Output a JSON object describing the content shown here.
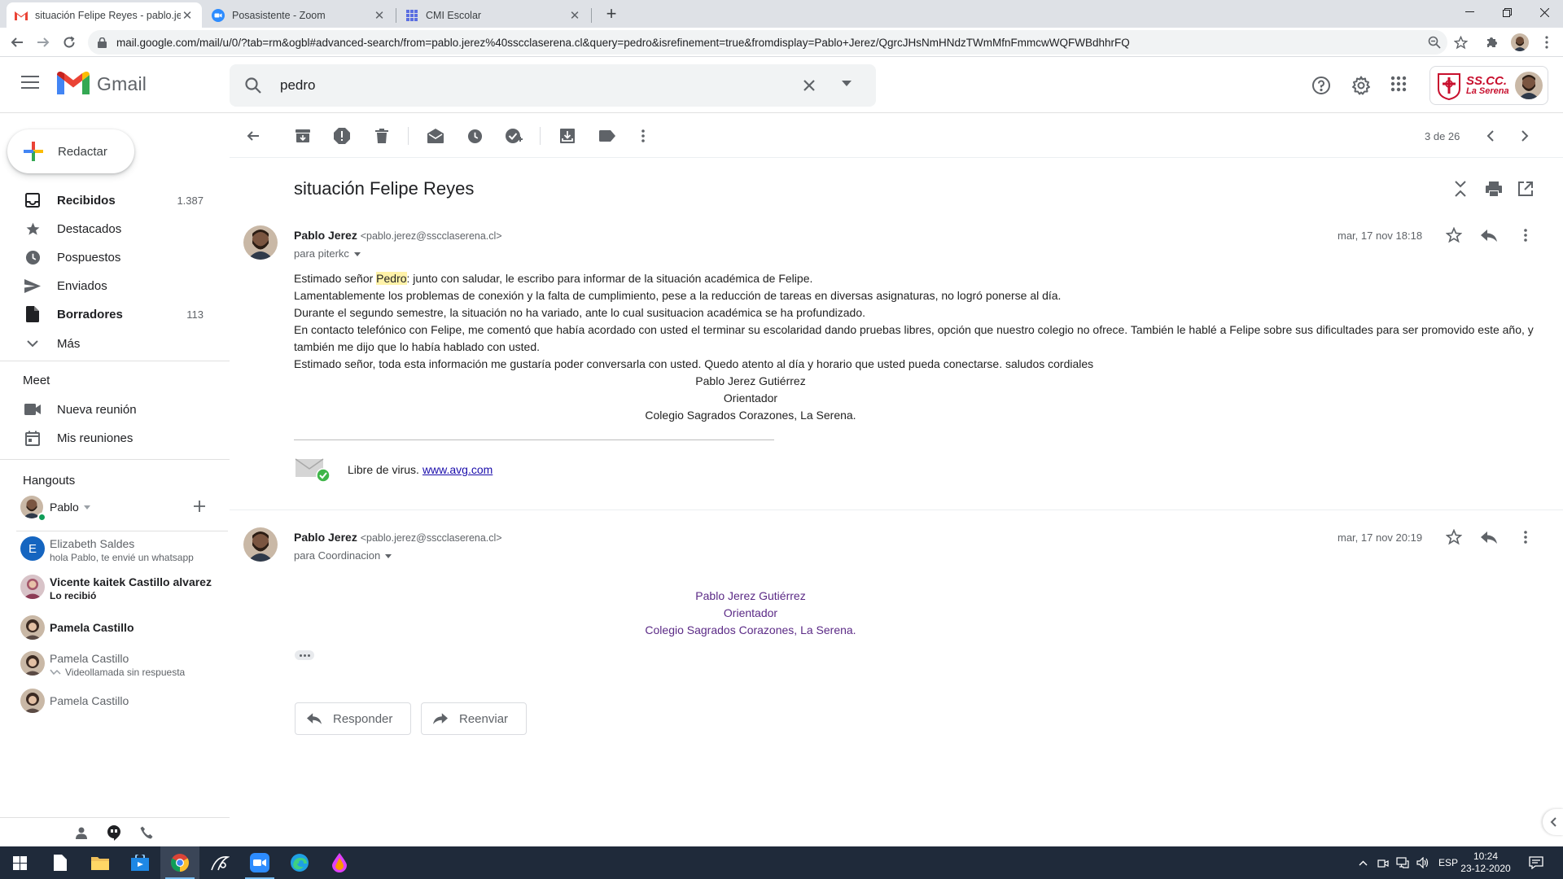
{
  "browser": {
    "tabs": [
      {
        "title": "situación Felipe Reyes - pablo.jerez@ssccla",
        "active": true
      },
      {
        "title": "Posasistente - Zoom",
        "active": false
      },
      {
        "title": "CMI Escolar",
        "active": false
      }
    ],
    "url": "mail.google.com/mail/u/0/?tab=rm&ogbl#advanced-search/from=pablo.jerez%40sscclaserena.cl&query=pedro&isrefinement=true&fromdisplay=Pablo+Jerez/QgrcJHsNmHNdzTWmMfnFmmcwWQFWBdhhrFQ"
  },
  "gmail": {
    "brand": "Gmail",
    "search_value": "pedro",
    "school": {
      "line1": "SS.CC.",
      "line2": "La Serena"
    }
  },
  "sidebar": {
    "compose_label": "Redactar",
    "items": [
      {
        "label": "Recibidos",
        "count": "1.387",
        "icon": "inbox-icon"
      },
      {
        "label": "Destacados",
        "count": "",
        "icon": "star-icon"
      },
      {
        "label": "Pospuestos",
        "count": "",
        "icon": "clock-icon"
      },
      {
        "label": "Enviados",
        "count": "",
        "icon": "send-icon"
      },
      {
        "label": "Borradores",
        "count": "113",
        "icon": "draft-icon"
      },
      {
        "label": "Más",
        "count": "",
        "icon": "chevron-down-icon"
      }
    ],
    "meet": {
      "title": "Meet",
      "items": [
        {
          "label": "Nueva reunión",
          "icon": "video-icon"
        },
        {
          "label": "Mis reuniones",
          "icon": "calendar-icon"
        }
      ]
    },
    "hangouts": {
      "title": "Hangouts",
      "self_name": "Pablo",
      "contacts": [
        {
          "name": "Elizabeth Saldes",
          "sub": "hola Pablo, te envié un whatsapp",
          "initial": "E",
          "unread": false
        },
        {
          "name": "Vicente kaitek Castillo alvarez",
          "sub": "Lo recibió",
          "initial": "",
          "unread": true
        },
        {
          "name": "Pamela Castillo",
          "sub": "",
          "initial": "",
          "unread": true
        },
        {
          "name": "Pamela Castillo",
          "sub": "Videollamada sin respuesta",
          "initial": "",
          "unread": false
        },
        {
          "name": "Pamela Castillo",
          "sub": "",
          "initial": "",
          "unread": false
        }
      ]
    }
  },
  "thread": {
    "pager": "3 de 26",
    "subject": "situación Felipe Reyes",
    "messages": [
      {
        "sender_name": "Pablo Jerez",
        "sender_email": "<pablo.jerez@sscclaserena.cl>",
        "to": "para piterkc",
        "date": "mar, 17 nov 18:18",
        "body": {
          "greeting_pre": "Estimado señor ",
          "greeting_hl": "Pedro",
          "greeting_post": ": junto con saludar, le escribo para informar de la situación académica de Felipe.",
          "p2": "Lamentablemente los problemas de conexión y la falta de cumplimiento, pese a la reducción de tareas en diversas asignaturas, no logró ponerse al día.",
          "p3": "Durante el segundo semestre, la situación no ha variado, ante lo cual susituacion académica se ha profundizado.",
          "p4": "En contacto telefónico con Felipe, me comentó que había acordado con usted el terminar su escolaridad dando pruebas libres, opción que nuestro colegio no ofrece. También le hablé a Felipe sobre sus dificultades para ser promovido este año, y también me dijo que lo había hablado con usted.",
          "p5": "Estimado señor, toda esta información me gustaría poder conversarla con usted. Quedo atento al día y horario que usted pueda conectarse.  saludos cordiales",
          "sig_name": "Pablo Jerez Gutiérrez",
          "sig_role": "Orientador",
          "sig_org": "Colegio Sagrados Corazones, La Serena."
        },
        "avg_text": "Libre de virus.",
        "avg_link": "www.avg.com"
      },
      {
        "sender_name": "Pablo Jerez",
        "sender_email": "<pablo.jerez@sscclaserena.cl>",
        "to": "para Coordinacion",
        "date": "mar, 17 nov 20:19",
        "sig_name": "Pablo Jerez Gutiérrez",
        "sig_role": "Orientador",
        "sig_org": "Colegio Sagrados Corazones, La Serena."
      }
    ],
    "reply_label": "Responder",
    "forward_label": "Reenviar"
  },
  "taskbar": {
    "lang": "ESP",
    "time": "10:24",
    "date": "23-12-2020"
  },
  "colors": {
    "accent_blue": "#1a73e8",
    "gmail_red": "#ea4335",
    "school_red": "#c8102e",
    "signature_purple": "#5b2a86",
    "highlight": "#fff2a8"
  }
}
